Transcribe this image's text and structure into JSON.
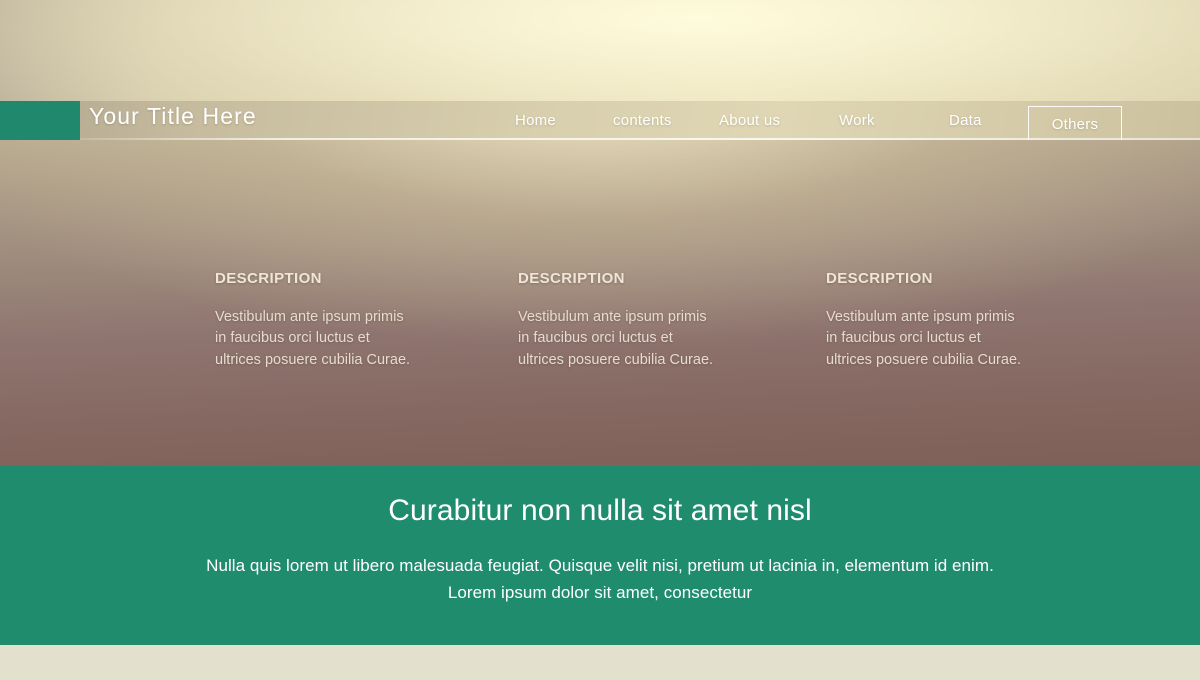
{
  "slide": {
    "title": "Your  Title  Here",
    "accent_color": "#20896D",
    "banner_color": "#1F8C6E",
    "footer_color": "#E3E0CE"
  },
  "nav": {
    "items": [
      {
        "label": "Home",
        "active": false
      },
      {
        "label": "contents",
        "active": false
      },
      {
        "label": "About us",
        "active": false
      },
      {
        "label": "Work",
        "active": false
      },
      {
        "label": "Data",
        "active": false
      }
    ],
    "active_tab": {
      "label": "Others",
      "active": true
    }
  },
  "columns": [
    {
      "heading": "DESCRIPTION",
      "body": "Vestibulum ante ipsum primis in faucibus orci luctus et ultrices posuere cubilia Curae."
    },
    {
      "heading": "DESCRIPTION",
      "body": "Vestibulum ante ipsum primis in faucibus orci luctus et ultrices posuere cubilia Curae."
    },
    {
      "heading": "DESCRIPTION",
      "body": "Vestibulum ante ipsum primis in faucibus orci luctus et ultrices posuere cubilia Curae."
    }
  ],
  "banner": {
    "heading": "Curabitur non nulla sit amet nisl",
    "subtext": "Nulla quis lorem ut libero malesuada feugiat. Quisque velit nisi, pretium ut lacinia in, elementum id enim. Lorem ipsum dolor sit amet, consectetur"
  }
}
